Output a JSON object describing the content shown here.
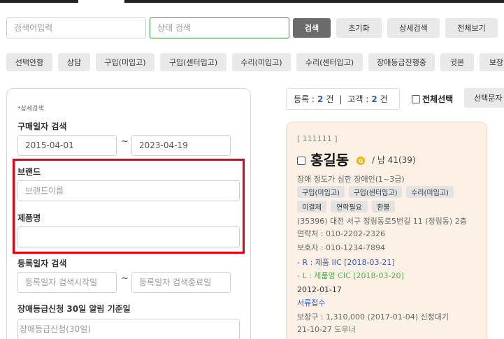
{
  "search": {
    "keyword_placeholder": "검색어입력",
    "status_placeholder": "상태 검색",
    "search_label": "검색",
    "reset_label": "초기화",
    "detail_label": "상세검색",
    "view_all_label": "전체보기"
  },
  "filters": [
    "선택안함",
    "상담",
    "구입(미입고)",
    "구입(센터입고)",
    "수리(미입고)",
    "수리(센터입고)",
    "장애등급진행중",
    "귓본",
    "보장"
  ],
  "detail": {
    "title": "*상세검색",
    "purchase_date_label": "구매일자 검색",
    "purchase_start": "2015-04-01",
    "purchase_end": "2023-04-19",
    "tilde": "~",
    "brand_label": "브랜드",
    "brand_placeholder": "브랜드이름",
    "product_label": "제품명",
    "product_value": "",
    "reg_date_label": "등록일자 검색",
    "reg_start_placeholder": "등록일자 검색시작일",
    "reg_end_placeholder": "등록일자 검색종료일",
    "disability_label": "장애등급신청 30일 알림 기준일",
    "disability_placeholder": "장애등급신청(30일)"
  },
  "summary": {
    "reg_label": "등록 :",
    "reg_count": "2",
    "reg_unit": "건",
    "sep": "|",
    "cust_label": "고객 :",
    "cust_count": "2",
    "cust_unit": "건",
    "select_all_label": "전체선택",
    "select_doc_label": "선택문자"
  },
  "card": {
    "id": "[ 111111 ]",
    "name": "홍길동",
    "badge": "G",
    "meta": "/ 남 41(39)",
    "desc": "장애 정도가 심한 장애인(1~3급)",
    "tags_row1": [
      "구입(미입고)",
      "구입(센터입고)",
      "수리(미입고)"
    ],
    "tags_row2": [
      "미결제",
      "연락필요",
      "환불"
    ],
    "address": "(35396) 대전 서구 정림동로5번길 11 (정림동) 2층",
    "contact": "연락처 : 010-2202-2326",
    "guardian": "보호자 : 010-1234-7894",
    "product_r": "- R : 제품 IIC [2018-03-21]",
    "product_l": "- L : 제품명 CIC [2018-03-20]",
    "date": "2012-01-17",
    "doc_status": "서류접수",
    "warranty": "보장구 : 1,310,000 (2017-01-04) 신청대기",
    "last_line": "21-10-27 도우너"
  },
  "colors": {
    "accent_green": "#3a8f3e",
    "highlight_red": "#e50012",
    "link_blue": "#2a5bd7",
    "link_green": "#4caf50",
    "card_bg": "#fdf1e6"
  }
}
